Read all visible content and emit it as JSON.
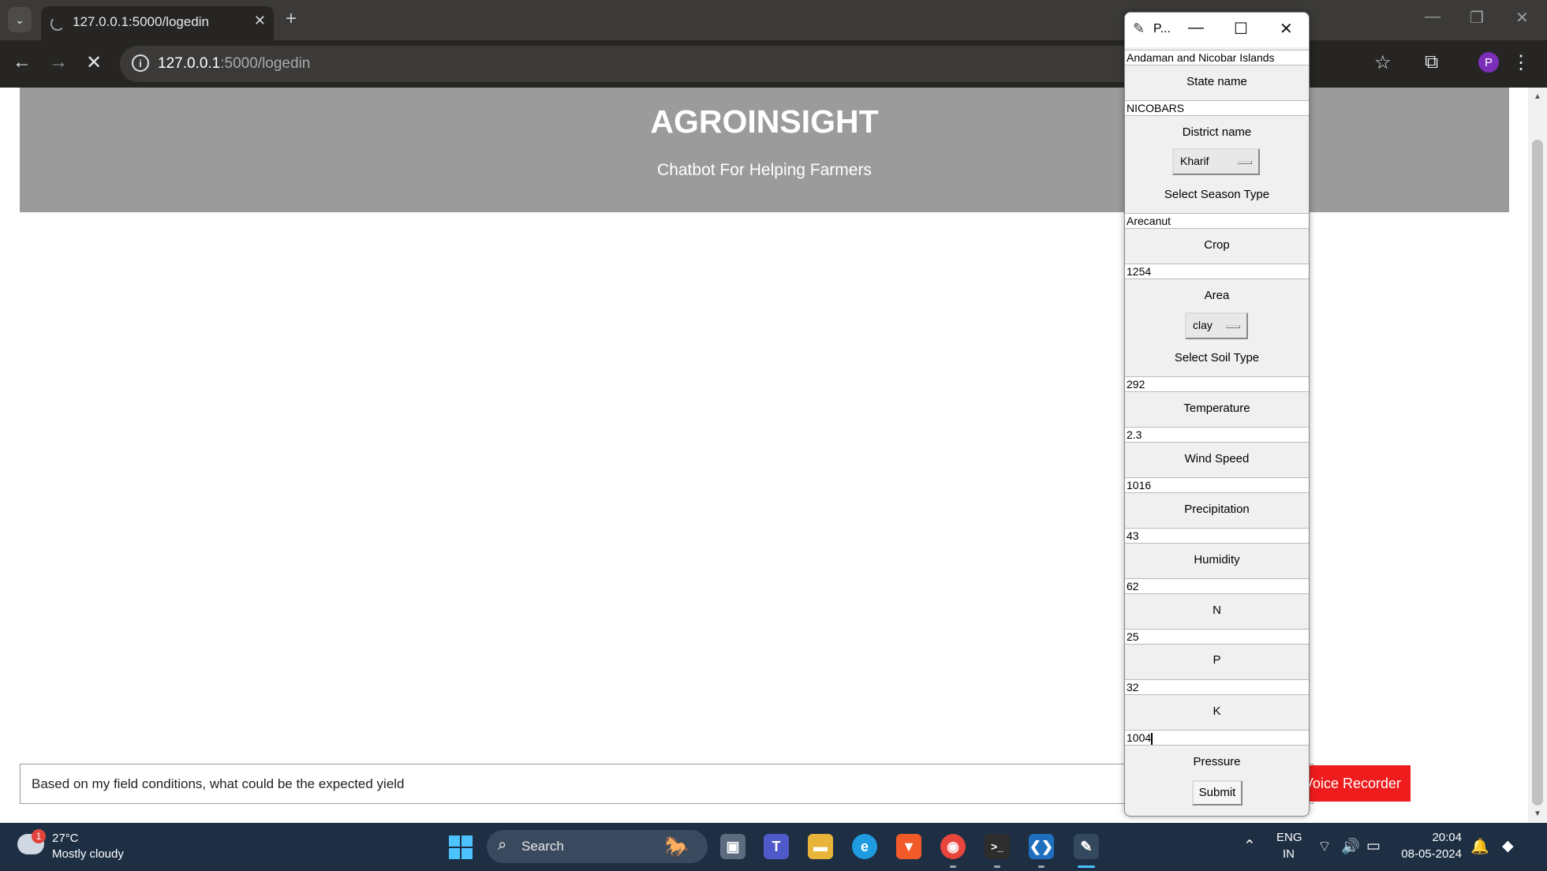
{
  "browser": {
    "tab_title": "127.0.0.1:5000/logedin",
    "url_host": "127.0.0.1",
    "url_path": ":5000/logedin",
    "profile_initial": "P"
  },
  "page": {
    "title": "AGROINSIGHT",
    "subtitle": "Chatbot For Helping Farmers",
    "chat_input_value": "Based on my field conditions, what could be the expected yield",
    "voice_button": "Voice Recorder"
  },
  "tk_window": {
    "title": "P...",
    "state_value": "Andaman and Nicobar Islands",
    "state_label": "State name",
    "district_value": "NICOBARS",
    "district_label": "District name",
    "season_selected": "Kharif",
    "season_label": "Select Season Type",
    "crop_value": "Arecanut",
    "crop_label": "Crop",
    "area_value": "1254",
    "area_label": "Area",
    "soil_selected": "clay",
    "soil_label": "Select Soil Type",
    "temperature_value": "292",
    "temperature_label": "Temperature",
    "wind_value": "2.3",
    "wind_label": "Wind Speed",
    "precip_value": "1016",
    "precip_label": "Precipitation",
    "humidity_value": "43",
    "humidity_label": "Humidity",
    "n_value": "62",
    "n_label": "N",
    "p_value": "25",
    "p_label": "P",
    "k_value": "32",
    "k_label": "K",
    "pressure_value": "1004",
    "pressure_label": "Pressure",
    "submit_label": "Submit"
  },
  "taskbar": {
    "weather_badge": "1",
    "temperature": "27°C",
    "weather_desc": "Mostly cloudy",
    "search_label": "Search",
    "lang_top": "ENG",
    "lang_bottom": "IN",
    "time": "20:04",
    "date": "08-05-2024"
  }
}
